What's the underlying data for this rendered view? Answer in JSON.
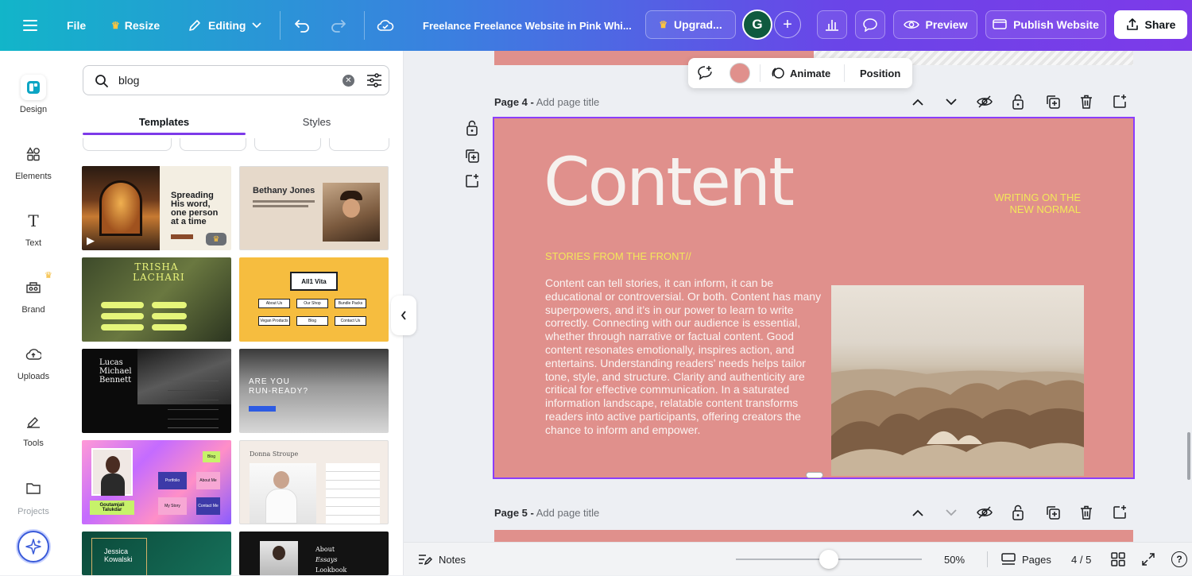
{
  "topbar": {
    "file": "File",
    "resize": "Resize",
    "mode": "Editing",
    "doc_title": "Freelance Freelance Website in Pink Whi...",
    "upgrade": "Upgrad...",
    "avatar_initial": "G",
    "preview": "Preview",
    "publish": "Publish Website",
    "share": "Share"
  },
  "rail": [
    {
      "label": "Design",
      "icon": "design-icon"
    },
    {
      "label": "Elements",
      "icon": "elements-icon"
    },
    {
      "label": "Text",
      "icon": "text-icon"
    },
    {
      "label": "Brand",
      "icon": "brand-icon"
    },
    {
      "label": "Uploads",
      "icon": "uploads-icon"
    },
    {
      "label": "Tools",
      "icon": "tools-icon"
    },
    {
      "label": "Projects",
      "icon": "projects-icon"
    }
  ],
  "panel": {
    "search_value": "blog",
    "tabs": [
      "Templates",
      "Styles"
    ],
    "active_tab": "Templates",
    "templates": [
      {
        "name": "Spreading His word, one person at a time",
        "line1": "Spreading",
        "line2": "His word,",
        "line3": "one person",
        "line4": "at a time"
      },
      {
        "name": "Bethany Jones",
        "title": "Bethany Jones"
      },
      {
        "name": "Trisha Lachari",
        "title": "TRISHA LACHARI"
      },
      {
        "name": "All1 Vita",
        "title": "All1 Vita",
        "buttons": [
          "About Us",
          "Our Shop",
          "Bundle Packs",
          "Vegan Products",
          "Blog",
          "Contact Us"
        ]
      },
      {
        "name": "Lucas Michael Bennett",
        "title1": "Lucas",
        "title2": "Michael",
        "title3": "Bennett"
      },
      {
        "name": "Are you run-ready?",
        "title1": "ARE YOU",
        "title2": "RUN-READY?"
      },
      {
        "name": "Goutamjali Talukdar",
        "title": "Goutamjali Talukdar",
        "tags": [
          "Blog",
          "Portfolio",
          "About Me",
          "My Story",
          "Contact Me"
        ]
      },
      {
        "name": "Donna Stroupe",
        "title": "Donna Stroupe"
      },
      {
        "name": "Jessica Kowalski",
        "title1": "Jessica",
        "title2": "Kowalski"
      },
      {
        "name": "About Essays Lookbook",
        "items": [
          "About",
          "Essays",
          "Lookbook"
        ]
      }
    ]
  },
  "float_toolbar": {
    "animate": "Animate",
    "position": "Position",
    "color": "#e0908c"
  },
  "pages": {
    "page4_label": "Page 4 -",
    "page4_title_placeholder": "Add page title",
    "page5_label": "Page 5 -",
    "page5_title_placeholder": "Add page title"
  },
  "slide": {
    "bg_color": "#e0908c",
    "heading": "Content",
    "tagline1": "WRITING ON THE",
    "tagline2": "NEW NORMAL",
    "subheading": "STORIES FROM THE FRONT//",
    "body": "Content can tell stories, it can inform, it can be educational or controversial. Or both. Content has many superpowers, and it’s in our power to learn to write correctly. Connecting with our audience is essential, whether through narrative or factual content. Good content resonates emotionally, inspires action, and entertains. Understanding readers’ needs helps tailor tone, style, and structure. Clarity and authenticity are critical for effective communication. In a saturated information landscape, relatable content transforms readers into active participants, offering creators the chance to inform and empower.",
    "accent_color": "#f3e85a"
  },
  "bottombar": {
    "notes": "Notes",
    "zoom_level": "50%",
    "zoom_fraction": 0.5,
    "pages": "Pages",
    "page_count": "4 / 5"
  }
}
